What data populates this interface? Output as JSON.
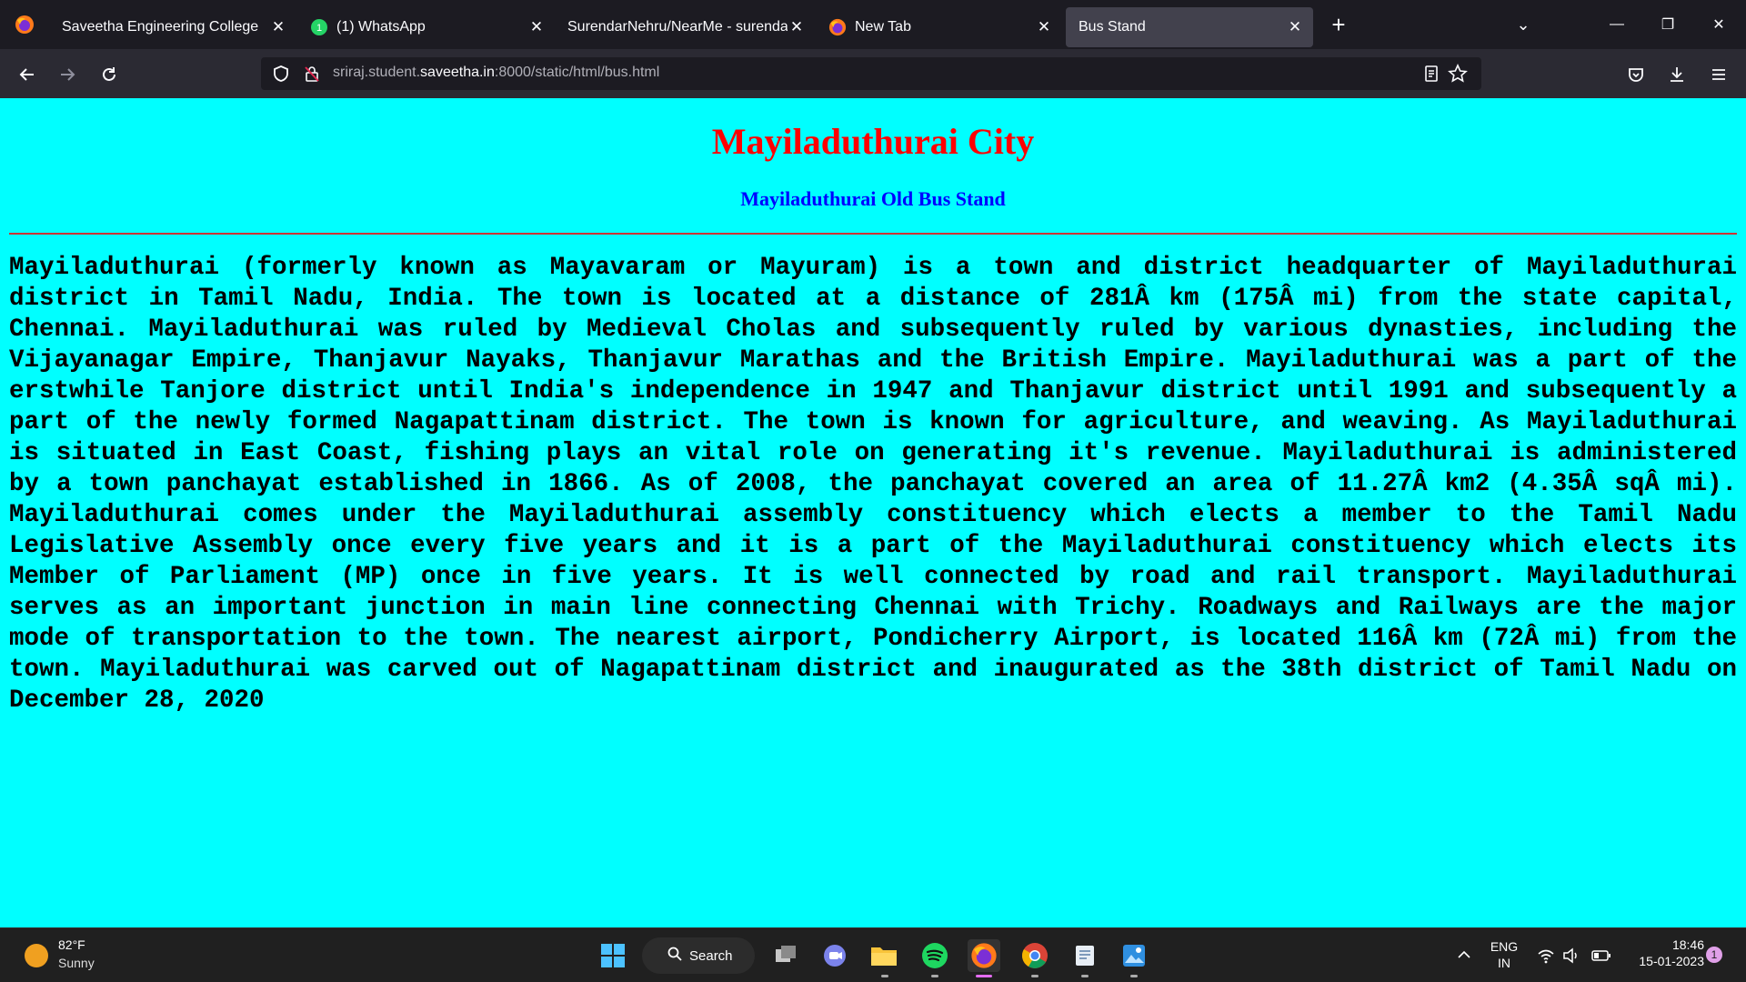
{
  "browser": {
    "tabs": [
      {
        "title": "Saveetha Engineering College",
        "icon": "none"
      },
      {
        "title": "(1) WhatsApp",
        "icon": "whatsapp-icon"
      },
      {
        "title": "SurendarNehru/NearMe - surendar",
        "icon": "none"
      },
      {
        "title": "New Tab",
        "icon": "firefox-icon"
      },
      {
        "title": "Bus Stand",
        "icon": "none",
        "active": true
      }
    ],
    "url_prefix": "sriraj.student.",
    "url_domain": "saveetha.in",
    "url_suffix": ":8000/static/html/bus.html"
  },
  "page": {
    "title": "Mayiladuthurai City",
    "subtitle": "Mayiladuthurai Old Bus Stand",
    "body": "Mayiladuthurai (formerly known as Mayavaram or Mayuram) is a town and district headquarter of Mayiladuthurai district in Tamil Nadu, India. The town is located at a distance of 281Â km (175Â mi) from the state capital, Chennai. Mayiladuthurai was ruled by Medieval Cholas and subsequently ruled by various dynasties, including the Vijayanagar Empire, Thanjavur Nayaks, Thanjavur Marathas and the British Empire. Mayiladuthurai was a part of the erstwhile Tanjore district until India's independence in 1947 and Thanjavur district until 1991 and subsequently a part of the newly formed Nagapattinam district. The town is known for agriculture, and weaving. As Mayiladuthurai is situated in East Coast, fishing plays an vital role on generating it's revenue. Mayiladuthurai is administered by a town panchayat established in 1866. As of 2008, the panchayat covered an area of 11.27Â km2 (4.35Â sqÂ mi). Mayiladuthurai comes under the Mayiladuthurai assembly constituency which elects a member to the Tamil Nadu Legislative Assembly once every five years and it is a part of the Mayiladuthurai constituency which elects its Member of Parliament (MP) once in five years. It is well connected by road and rail transport. Mayiladuthurai serves as an important junction in main line connecting Chennai with Trichy. Roadways and Railways are the major mode of transportation to the town. The nearest airport, Pondicherry Airport, is located 116Â km (72Â mi) from the town. Mayiladuthurai was carved out of Nagapattinam district and inaugurated as the 38th district of Tamil Nadu on December 28, 2020",
    "colors": {
      "background": "#00ffff",
      "title": "#ff0000",
      "subtitle": "#0000ff"
    }
  },
  "taskbar": {
    "weather_temp": "82°F",
    "weather_condition": "Sunny",
    "search_label": "Search",
    "language_line1": "ENG",
    "language_line2": "IN",
    "time": "18:46",
    "date": "15-01-2023",
    "notification_count": "1"
  }
}
